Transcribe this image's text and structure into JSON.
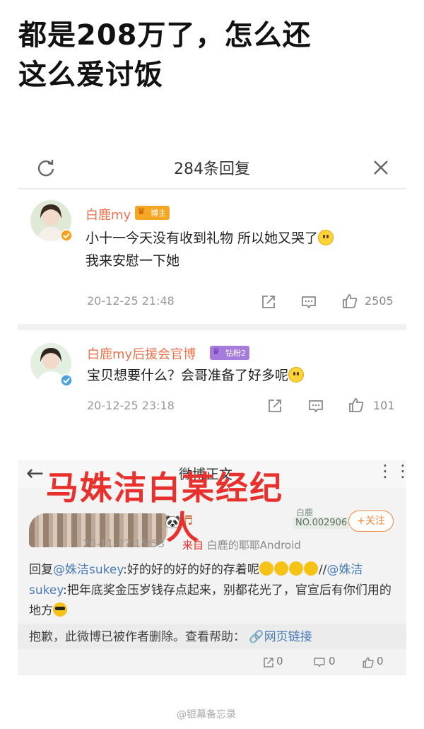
{
  "headline": {
    "line1": "都是208万了，怎么还",
    "line2": "这么爱讨饭"
  },
  "panel1": {
    "title": "284条回复",
    "comments": [
      {
        "name": "白鹿my",
        "badge": "博主",
        "text1": "小十一今天没有收到礼物 所以她又哭了",
        "text2": "我来安慰一下她",
        "time": "20-12-25 21:48",
        "likes": "2505"
      },
      {
        "name": "白鹿my后援会官博",
        "badge": "钻粉2",
        "text1": "宝贝想要什么？会哥准备了好多呢",
        "time": "20-12-25 23:18",
        "likes": "101"
      }
    ]
  },
  "panel2": {
    "title": "微博正文",
    "overlay_line1": "马姝洁白某经纪",
    "overlay_line2": "人",
    "time": "20-11-27 15:53",
    "source_prefix": "来自",
    "source": "白鹿的耶耶Android",
    "no_label": "白鹿",
    "no_number": "NO.002906",
    "follow": "+关注",
    "reply_prefix": "回复",
    "mention1": "@姝洁sukey",
    "text1": ":好的好的好的好的存着呢",
    "slash": "//",
    "mention2": "@姝洁sukey",
    "text2": ":把年底奖金压岁钱存点起来，别都花光了，官宣后有你们用的地方",
    "deleted": "抱歉，此微博已被作者删除。查看帮助：",
    "link": "网页链接",
    "counts": [
      "0",
      "0",
      "0"
    ]
  },
  "watermark": "@银幕备忘录",
  "colors": {
    "name": "#eb7350",
    "link": "#4a7bb7",
    "overlay": "#e8302c",
    "follow": "#f08a3c"
  }
}
